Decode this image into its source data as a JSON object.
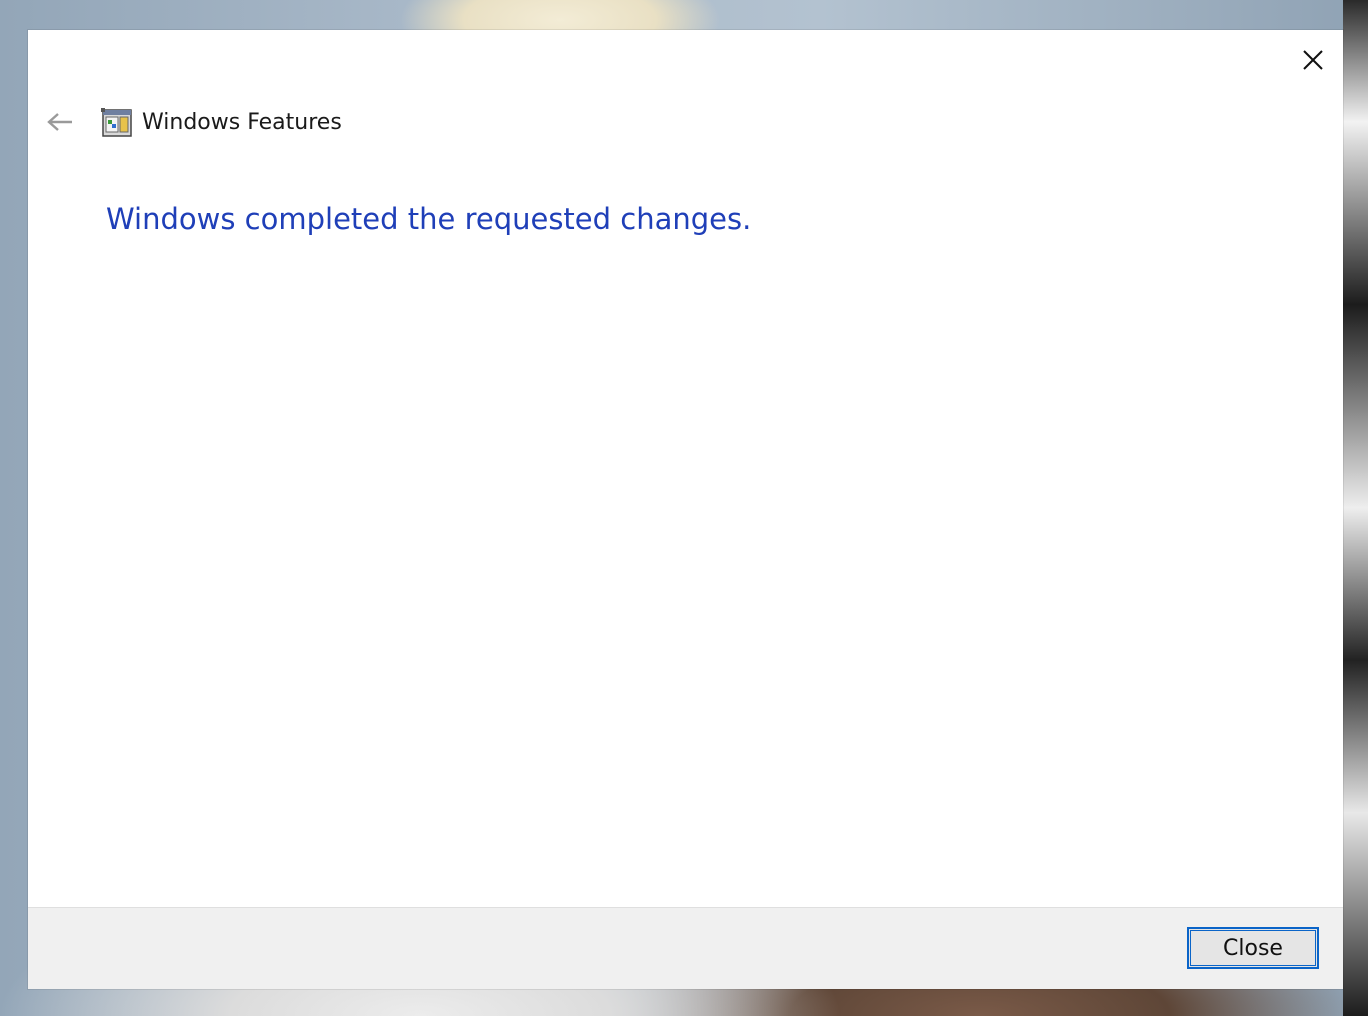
{
  "window": {
    "title": "Windows Features",
    "back_icon": "back-arrow-icon",
    "app_icon": "windows-features-icon",
    "close_icon": "close-icon"
  },
  "content": {
    "message": "Windows completed the requested changes.",
    "message_color": "#1f3fb8"
  },
  "footer": {
    "close_label": "Close",
    "accent": "#0a64c8"
  }
}
